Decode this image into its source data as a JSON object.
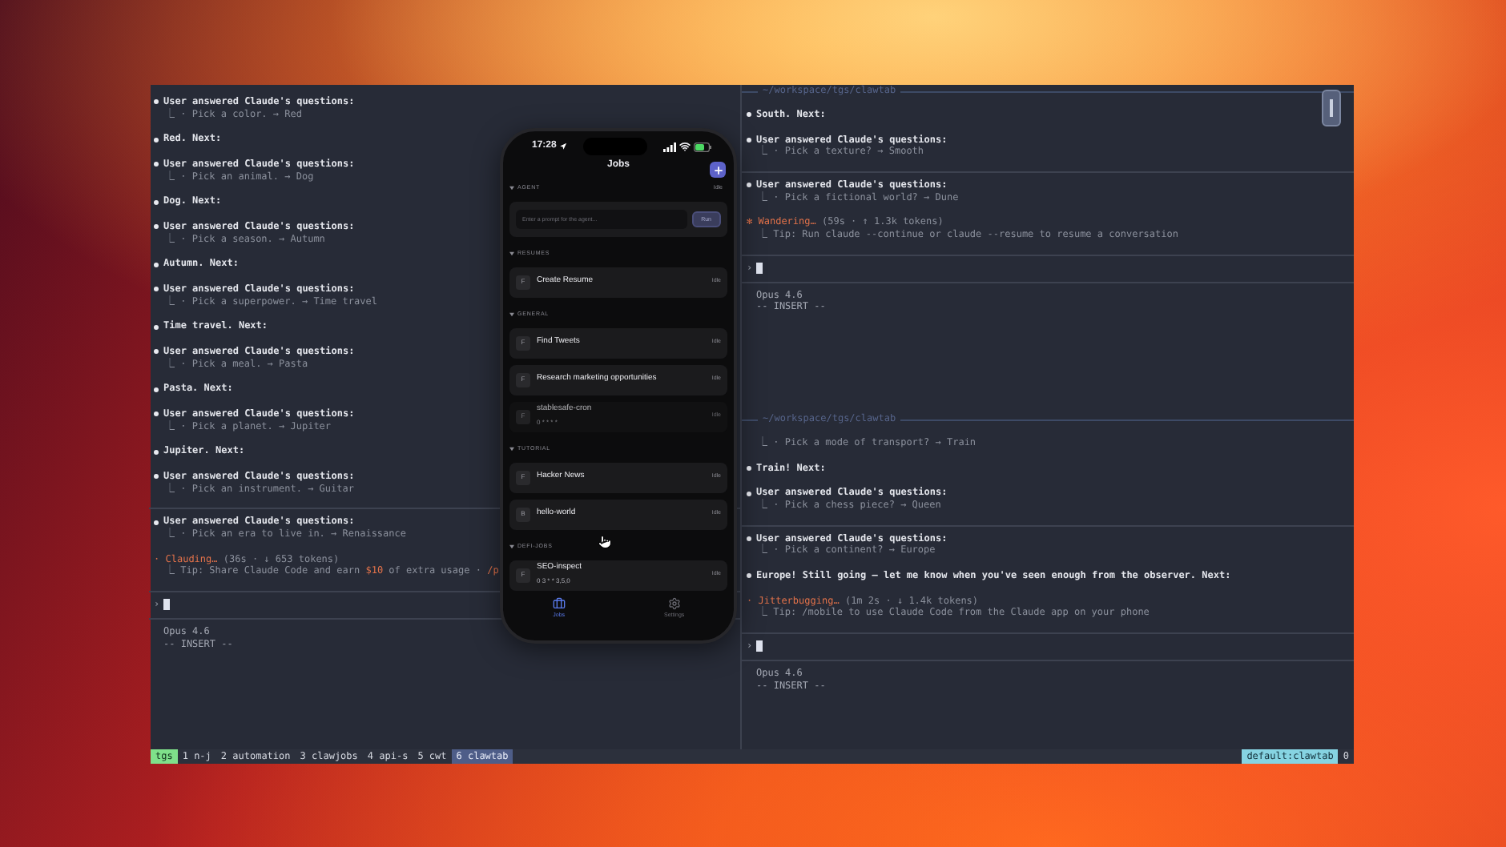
{
  "terminal": {
    "left_pane": {
      "entries": [
        {
          "kind": "answered",
          "title": "User answered Claude's questions:",
          "detail": "⎿ · Pick a color. → Red"
        },
        {
          "kind": "reply",
          "text": "Red. Next:"
        },
        {
          "kind": "answered",
          "title": "User answered Claude's questions:",
          "detail": "⎿ · Pick an animal. → Dog"
        },
        {
          "kind": "reply",
          "text": "Dog. Next:"
        },
        {
          "kind": "answered",
          "title": "User answered Claude's questions:",
          "detail": "⎿ · Pick a season. → Autumn"
        },
        {
          "kind": "reply",
          "text": "Autumn. Next:"
        },
        {
          "kind": "answered",
          "title": "User answered Claude's questions:",
          "detail": "⎿ · Pick a superpower. → Time travel"
        },
        {
          "kind": "reply",
          "text": "Time travel. Next:"
        },
        {
          "kind": "answered",
          "title": "User answered Claude's questions:",
          "detail": "⎿ · Pick a meal. → Pasta"
        },
        {
          "kind": "reply",
          "text": "Pasta. Next:"
        },
        {
          "kind": "answered",
          "title": "User answered Claude's questions:",
          "detail": "⎿ · Pick a planet. → Jupiter"
        },
        {
          "kind": "reply",
          "text": "Jupiter. Next:"
        },
        {
          "kind": "answered",
          "title": "User answered Claude's questions:",
          "detail": "⎿ · Pick an instrument. → Guitar"
        },
        {
          "kind": "divider"
        },
        {
          "kind": "answered",
          "title": "User answered Claude's questions:",
          "detail": "⎿ · Pick an era to live in. → Renaissance"
        },
        {
          "kind": "status",
          "spinner": "·",
          "verb": "Clauding…",
          "stats": "(36s · ↓ 653 tokens)",
          "tip": [
            {
              "text": "⎿ Tip: Share Claude Code and earn ",
              "accent": false
            },
            {
              "text": "$10",
              "accent": true
            },
            {
              "text": " of extra usage · ",
              "accent": false
            },
            {
              "text": "/p",
              "accent": true
            }
          ]
        },
        {
          "kind": "divider"
        },
        {
          "kind": "prompt",
          "symbol": "›"
        },
        {
          "kind": "divider"
        },
        {
          "kind": "footer",
          "model": "Opus 4.6",
          "mode": "-- INSERT --"
        }
      ]
    },
    "right_top_pane": {
      "title": "~/workspace/tgs/clawtab",
      "entries": [
        {
          "kind": "reply",
          "text": "South. Next:"
        },
        {
          "kind": "answered",
          "title": "User answered Claude's questions:",
          "detail": "⎿ · Pick a texture? → Smooth"
        },
        {
          "kind": "divider"
        },
        {
          "kind": "answered",
          "title": "User answered Claude's questions:",
          "detail": "⎿ · Pick a fictional world? → Dune"
        },
        {
          "kind": "status",
          "spinner": "✻",
          "verb": "Wandering…",
          "stats": "(59s · ↑ 1.3k tokens)",
          "tip": [
            {
              "text": "⎿ Tip: Run claude --continue or claude --resume to resume a conversation",
              "accent": false
            }
          ]
        },
        {
          "kind": "divider"
        },
        {
          "kind": "prompt",
          "symbol": "›"
        },
        {
          "kind": "divider"
        },
        {
          "kind": "footer",
          "model": "Opus 4.6",
          "mode": "-- INSERT --"
        }
      ]
    },
    "right_bottom_pane": {
      "title": "~/workspace/tgs/clawtab",
      "entries": [
        {
          "kind": "detail",
          "detail": "⎿ · Pick a mode of transport? → Train"
        },
        {
          "kind": "reply",
          "text": "Train! Next:"
        },
        {
          "kind": "answered",
          "title": "User answered Claude's questions:",
          "detail": "⎿ · Pick a chess piece? → Queen"
        },
        {
          "kind": "divider"
        },
        {
          "kind": "answered",
          "title": "User answered Claude's questions:",
          "detail": "⎿ · Pick a continent? → Europe"
        },
        {
          "kind": "reply",
          "text": "Europe! Still going — let me know when you've seen enough from the observer. Next:"
        },
        {
          "kind": "status",
          "spinner": "·",
          "verb": "Jitterbugging…",
          "stats": "(1m 2s · ↓ 1.4k tokens)",
          "tip": [
            {
              "text": "⎿ Tip: /mobile to use Claude Code from the Claude app on your phone",
              "accent": false
            }
          ]
        },
        {
          "kind": "divider"
        },
        {
          "kind": "prompt",
          "symbol": "›"
        },
        {
          "kind": "divider"
        },
        {
          "kind": "footer",
          "model": "Opus 4.6",
          "mode": "-- INSERT --"
        }
      ]
    },
    "status_bar": {
      "session": "tgs",
      "windows": [
        {
          "label": "1 n-j",
          "selected": false
        },
        {
          "label": "2 automation",
          "selected": false
        },
        {
          "label": "3 clawjobs",
          "selected": false
        },
        {
          "label": "4 api-s",
          "selected": false
        },
        {
          "label": "5 cwt",
          "selected": false
        },
        {
          "label": "6 clawtab",
          "selected": true
        }
      ],
      "target": "default:clawtab",
      "index": "0"
    }
  },
  "phone": {
    "time": "17:28",
    "title": "Jobs",
    "sections": [
      {
        "name": "AGENT",
        "kind": "agent",
        "status": "Idle",
        "placeholder": "Enter a prompt for the agent...",
        "button": "Run"
      },
      {
        "name": "RESUMES",
        "kind": "jobs",
        "jobs": [
          {
            "badge": "F",
            "name": "Create Resume",
            "status": "Idle",
            "disabled": false
          }
        ]
      },
      {
        "name": "GENERAL",
        "kind": "jobs",
        "jobs": [
          {
            "badge": "F",
            "name": "Find Tweets",
            "status": "Idle",
            "disabled": false
          },
          {
            "badge": "F",
            "name": "Research marketing opportunities",
            "status": "Idle",
            "disabled": false
          },
          {
            "badge": "F",
            "name": "stablesafe-cron",
            "schedule": "0 * * * *",
            "status": "Idle",
            "disabled": true
          }
        ]
      },
      {
        "name": "TUTORIAL",
        "kind": "jobs",
        "jobs": [
          {
            "badge": "F",
            "name": "Hacker News",
            "status": "Idle",
            "disabled": false
          },
          {
            "badge": "B",
            "name": "hello-world",
            "status": "Idle",
            "disabled": false
          }
        ]
      },
      {
        "name": "DEFI-JOBS",
        "kind": "jobs",
        "jobs": [
          {
            "badge": "F",
            "name": "SEO-inspect",
            "schedule": "0 3 * * 3,5,0",
            "status": "Idle",
            "disabled": false
          }
        ]
      }
    ],
    "tabs": [
      {
        "label": "Jobs",
        "kind": "jobs",
        "selected": true
      },
      {
        "label": "Settings",
        "kind": "settings",
        "selected": false
      }
    ]
  }
}
